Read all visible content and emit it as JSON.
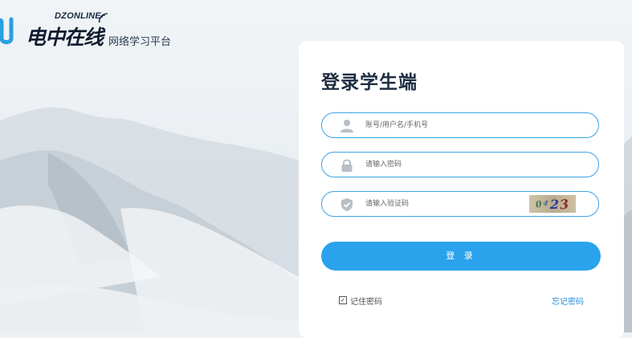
{
  "brand": {
    "logo_en": "DZONLINE",
    "logo_cn": "电中在线",
    "tagline": "网络学习平台"
  },
  "login": {
    "title": "登录学生端",
    "username_placeholder": "账号/用户名/手机号",
    "password_placeholder": "请输入密码",
    "captcha_placeholder": "请输入验证码",
    "captcha_chars": [
      "0",
      "4",
      "2",
      "3"
    ],
    "submit_label": "登 录",
    "remember_label": "记住密码",
    "remember_checked": true,
    "forgot_label": "忘记密码"
  },
  "icons": {
    "username": "user-icon",
    "password": "lock-icon",
    "captcha": "shield-check-icon"
  },
  "colors": {
    "accent": "#2aa3ec",
    "field_border": "#3aa3e6",
    "icon_gray": "#b8bec6",
    "title": "#1e2d42",
    "link": "#2a8fd6"
  }
}
